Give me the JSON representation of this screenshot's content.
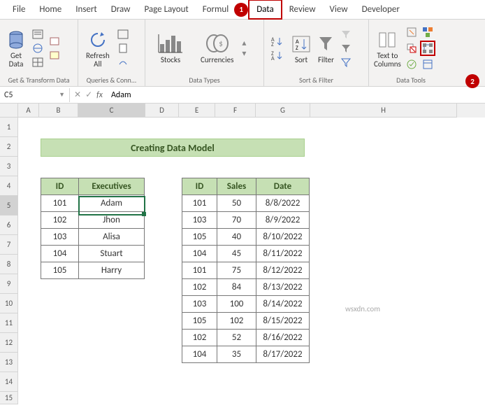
{
  "tabs": [
    "File",
    "Home",
    "Insert",
    "Draw",
    "Page Layout",
    "Formul",
    "Data",
    "Review",
    "View",
    "Developer"
  ],
  "active_tab_index": 6,
  "markers": {
    "one": "1",
    "two": "2"
  },
  "ribbon": {
    "get_data": "Get\nData",
    "group_get": "Get & Transform Data",
    "refresh": "Refresh\nAll",
    "group_queries": "Queries & Conn...",
    "stocks": "Stocks",
    "currencies": "Currencies",
    "group_datatypes": "Data Types",
    "sort": "Sort",
    "filter": "Filter",
    "group_sort": "Sort & Filter",
    "t2c": "Text to\nColumns",
    "group_tools": "Data Tools"
  },
  "namebox": "C5",
  "formula_value": "Adam",
  "cols": [
    "A",
    "B",
    "C",
    "D",
    "E",
    "F",
    "G",
    "H"
  ],
  "rows": [
    "1",
    "2",
    "3",
    "4",
    "5",
    "6",
    "7",
    "8",
    "9",
    "10",
    "11",
    "12",
    "13",
    "14",
    "15"
  ],
  "title": "Creating Data Model",
  "table1": {
    "headers": [
      "ID",
      "Executives"
    ],
    "rows": [
      [
        "101",
        "Adam"
      ],
      [
        "102",
        "Jhon"
      ],
      [
        "103",
        "Alisa"
      ],
      [
        "104",
        "Stuart"
      ],
      [
        "105",
        "Harry"
      ]
    ]
  },
  "table2": {
    "headers": [
      "ID",
      "Sales",
      "Date"
    ],
    "rows": [
      [
        "101",
        "50",
        "8/8/2022"
      ],
      [
        "103",
        "70",
        "8/9/2022"
      ],
      [
        "105",
        "40",
        "8/10/2022"
      ],
      [
        "104",
        "45",
        "8/11/2022"
      ],
      [
        "101",
        "75",
        "8/12/2022"
      ],
      [
        "102",
        "84",
        "8/13/2022"
      ],
      [
        "103",
        "100",
        "8/14/2022"
      ],
      [
        "105",
        "102",
        "8/15/2022"
      ],
      [
        "102",
        "52",
        "8/16/2022"
      ],
      [
        "104",
        "35",
        "8/17/2022"
      ]
    ]
  },
  "watermark": "wsxdn.com"
}
